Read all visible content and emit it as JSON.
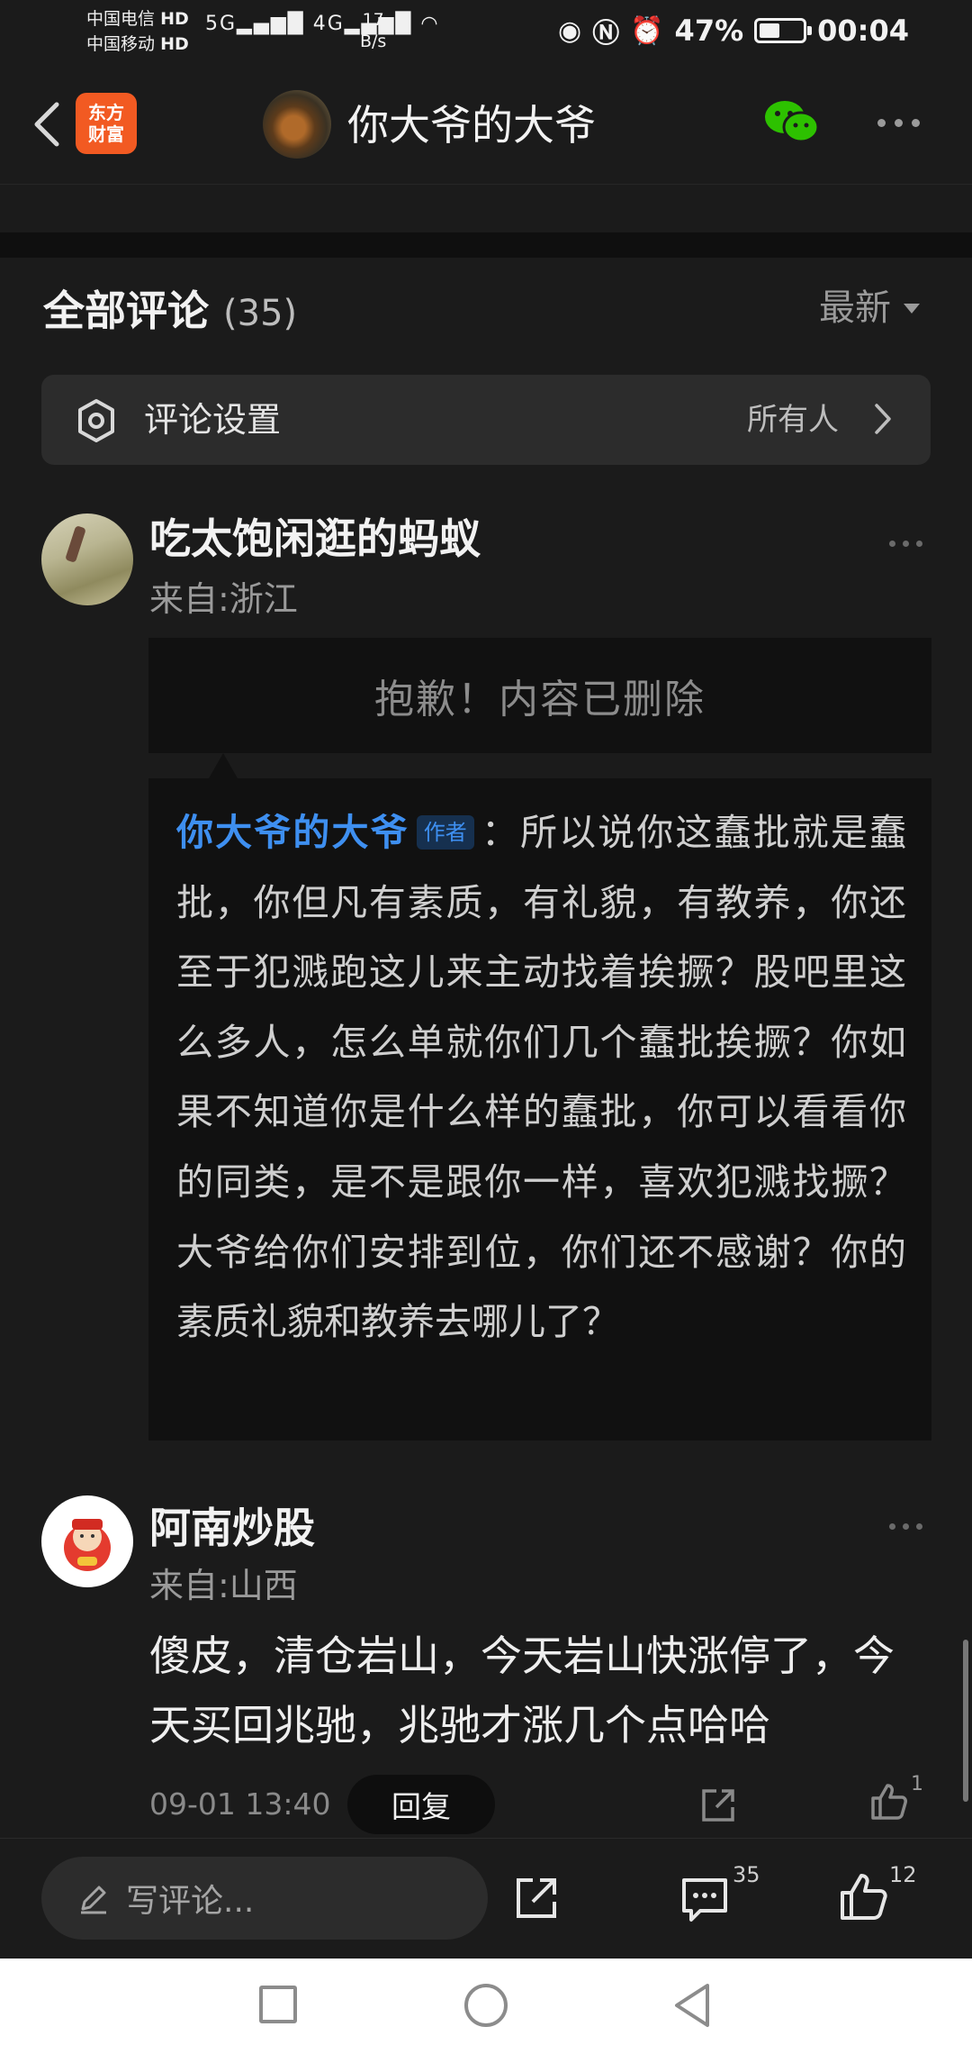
{
  "status_bar": {
    "carrier_1": "中国电信",
    "carrier_1_tag": "HD",
    "carrier_2": "中国移动",
    "carrier_2_tag": "HD",
    "network_1": "5G",
    "network_2": "4G",
    "speed_value": "17",
    "speed_unit": "B/s",
    "battery": "47%",
    "time": "00:04"
  },
  "header": {
    "app_logo_line1": "东方",
    "app_logo_line2": "财富",
    "title": "你大爷的大爷"
  },
  "comments_section": {
    "title": "全部评论",
    "count": "(35)",
    "sort_label": "最新",
    "settings_label": "评论设置",
    "settings_value": "所有人"
  },
  "comment_1": {
    "username": "吃太饱闲逛的蚂蚁",
    "location": "来自:浙江",
    "deleted_text": "抱歉！内容已删除",
    "reply_author": "你大爷的大爷",
    "author_tag": "作者",
    "reply_text": "：所以说你这蠢批就是蠢批，你但凡有素质，有礼貌，有教养，你还至于犯溅跑这儿来主动找着挨撅？股吧里这么多人，怎么单就你们几个蠢批挨撅？你如果不知道你是什么样的蠢批，你可以看看你的同类，是不是跟你一样，喜欢犯溅找撅？大爷给你们安排到位，你们还不感谢？你的素质礼貌和教养去哪儿了？"
  },
  "comment_2": {
    "username": "阿南炒股",
    "location": "来自:山西",
    "body": "傻皮，清仓岩山，今天岩山快涨停了，今天买回兆驰，兆驰才涨几个点哈哈",
    "time": "09-01 13:40",
    "reply_label": "回复",
    "like_count": "1"
  },
  "action_bar": {
    "compose_placeholder": "写评论...",
    "comment_count": "35",
    "like_count": "12"
  },
  "colors": {
    "background": "#1b1b1b",
    "link_blue": "#3e8ff0",
    "brand_orange": "#f25a22"
  }
}
